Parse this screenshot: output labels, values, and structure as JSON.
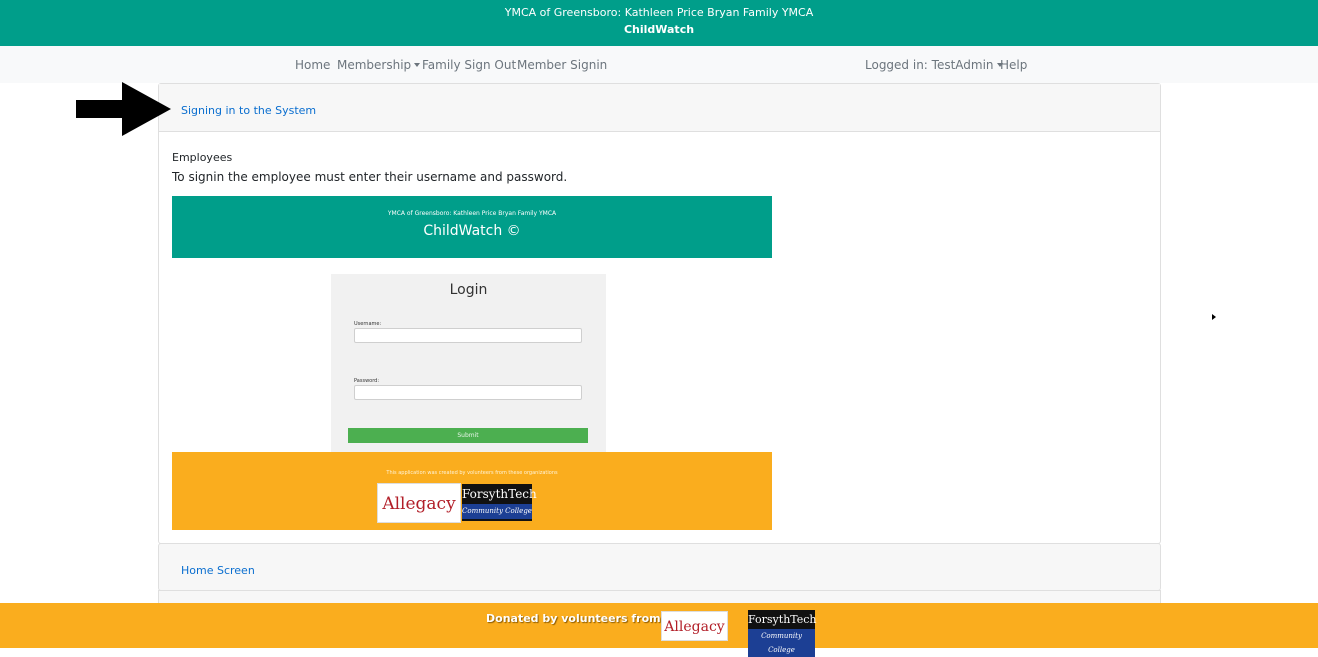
{
  "header": {
    "org": "YMCA of Greensboro: Kathleen Price Bryan Family YMCA",
    "app": "ChildWatch"
  },
  "nav": {
    "home": "Home",
    "membership": "Membership",
    "family_sign_out": "Family Sign Out",
    "member_signin": "Member Signin",
    "logged_in": "Logged in: TestAdmin",
    "help": "Help"
  },
  "accordion": {
    "section1": {
      "title": "Signing in to the System",
      "subtitle": "Employees",
      "text": "To signin the employee must enter their username and password."
    },
    "section2": {
      "title": "Home Screen"
    }
  },
  "screenshot": {
    "org": "YMCA of Greensboro: Kathleen Price Bryan Family YMCA",
    "app": "ChildWatch ©",
    "login_title": "Login",
    "username_label": "Username:",
    "password_label": "Password:",
    "submit_label": "Submit",
    "credit_note": "This application was created by volunteers from these organizations",
    "logo_allegacy": "Allegacy",
    "logo_forsyth": "ForsythTech",
    "logo_forsyth_sub": "Community College"
  },
  "footer": {
    "donated": "Donated by volunteers from:",
    "logo_allegacy": "Allegacy",
    "logo_forsyth": "ForsythTech",
    "logo_forsyth_sub": "Community College"
  },
  "colors": {
    "header_bg": "#009e8a",
    "footer_bg": "#faad1e",
    "link": "#0a6ecf",
    "submit_bg": "#4caf50"
  }
}
